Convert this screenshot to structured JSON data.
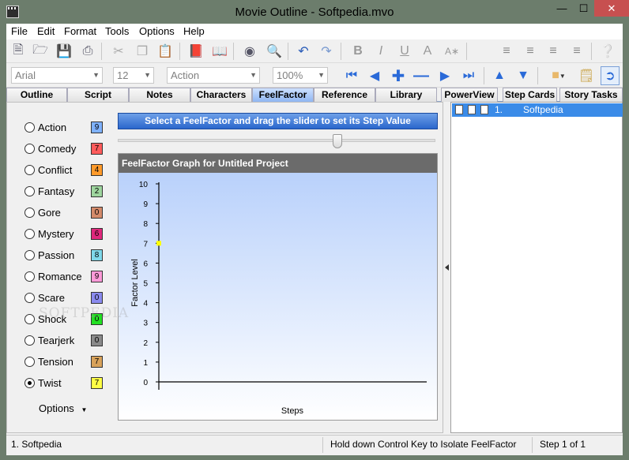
{
  "window": {
    "title": "Movie Outline - Softpedia.mvo"
  },
  "menu": [
    "File",
    "Edit",
    "Format",
    "Tools",
    "Options",
    "Help"
  ],
  "format_bar": {
    "font": "Arial",
    "size": "12",
    "style": "Action",
    "zoom": "100%"
  },
  "tabs": [
    "Outline",
    "Script",
    "Notes",
    "Characters",
    "FeelFactor",
    "Reference",
    "Library",
    "PowerView",
    "Step Cards",
    "Story Tasks"
  ],
  "active_tab": "FeelFactor",
  "factors": [
    {
      "label": "Action",
      "value": "9",
      "color": "#7fb2ff",
      "checked": false
    },
    {
      "label": "Comedy",
      "value": "7",
      "color": "#ff5b5b",
      "checked": false
    },
    {
      "label": "Conflict",
      "value": "4",
      "color": "#ff9a2a",
      "checked": false
    },
    {
      "label": "Fantasy",
      "value": "2",
      "color": "#9ed59e",
      "checked": false
    },
    {
      "label": "Gore",
      "value": "0",
      "color": "#d48a6a",
      "checked": false
    },
    {
      "label": "Mystery",
      "value": "6",
      "color": "#e0287c",
      "checked": false
    },
    {
      "label": "Passion",
      "value": "8",
      "color": "#7fd8ea",
      "checked": false
    },
    {
      "label": "Romance",
      "value": "9",
      "color": "#ff9ad8",
      "checked": false
    },
    {
      "label": "Scare",
      "value": "0",
      "color": "#8a8aee",
      "checked": false
    },
    {
      "label": "Shock",
      "value": "0",
      "color": "#22e022",
      "checked": false
    },
    {
      "label": "Tearjerk",
      "value": "0",
      "color": "#8a8a8a",
      "checked": false
    },
    {
      "label": "Tension",
      "value": "7",
      "color": "#d8a25a",
      "checked": false
    },
    {
      "label": "Twist",
      "value": "7",
      "color": "#ffff44",
      "checked": true
    }
  ],
  "options_label": "Options",
  "instruction": "Select a FeelFactor and drag the slider to set its Step Value",
  "slider_value": 7,
  "graph": {
    "title": "FeelFactor Graph for Untitled Project",
    "ylabel": "Factor Level",
    "xlabel": "Steps",
    "yticks": [
      "10",
      "9",
      "8",
      "7",
      "6",
      "5",
      "4",
      "3",
      "2",
      "1",
      "0"
    ],
    "point_value": 7,
    "point_color": "#ffff00"
  },
  "steps": [
    {
      "number": "1.",
      "name": "Softpedia"
    }
  ],
  "status": {
    "step": "1.  Softpedia",
    "hint": "Hold down Control Key to Isolate FeelFactor",
    "position": "Step 1 of 1"
  },
  "watermark": "SOFTPEDIA"
}
